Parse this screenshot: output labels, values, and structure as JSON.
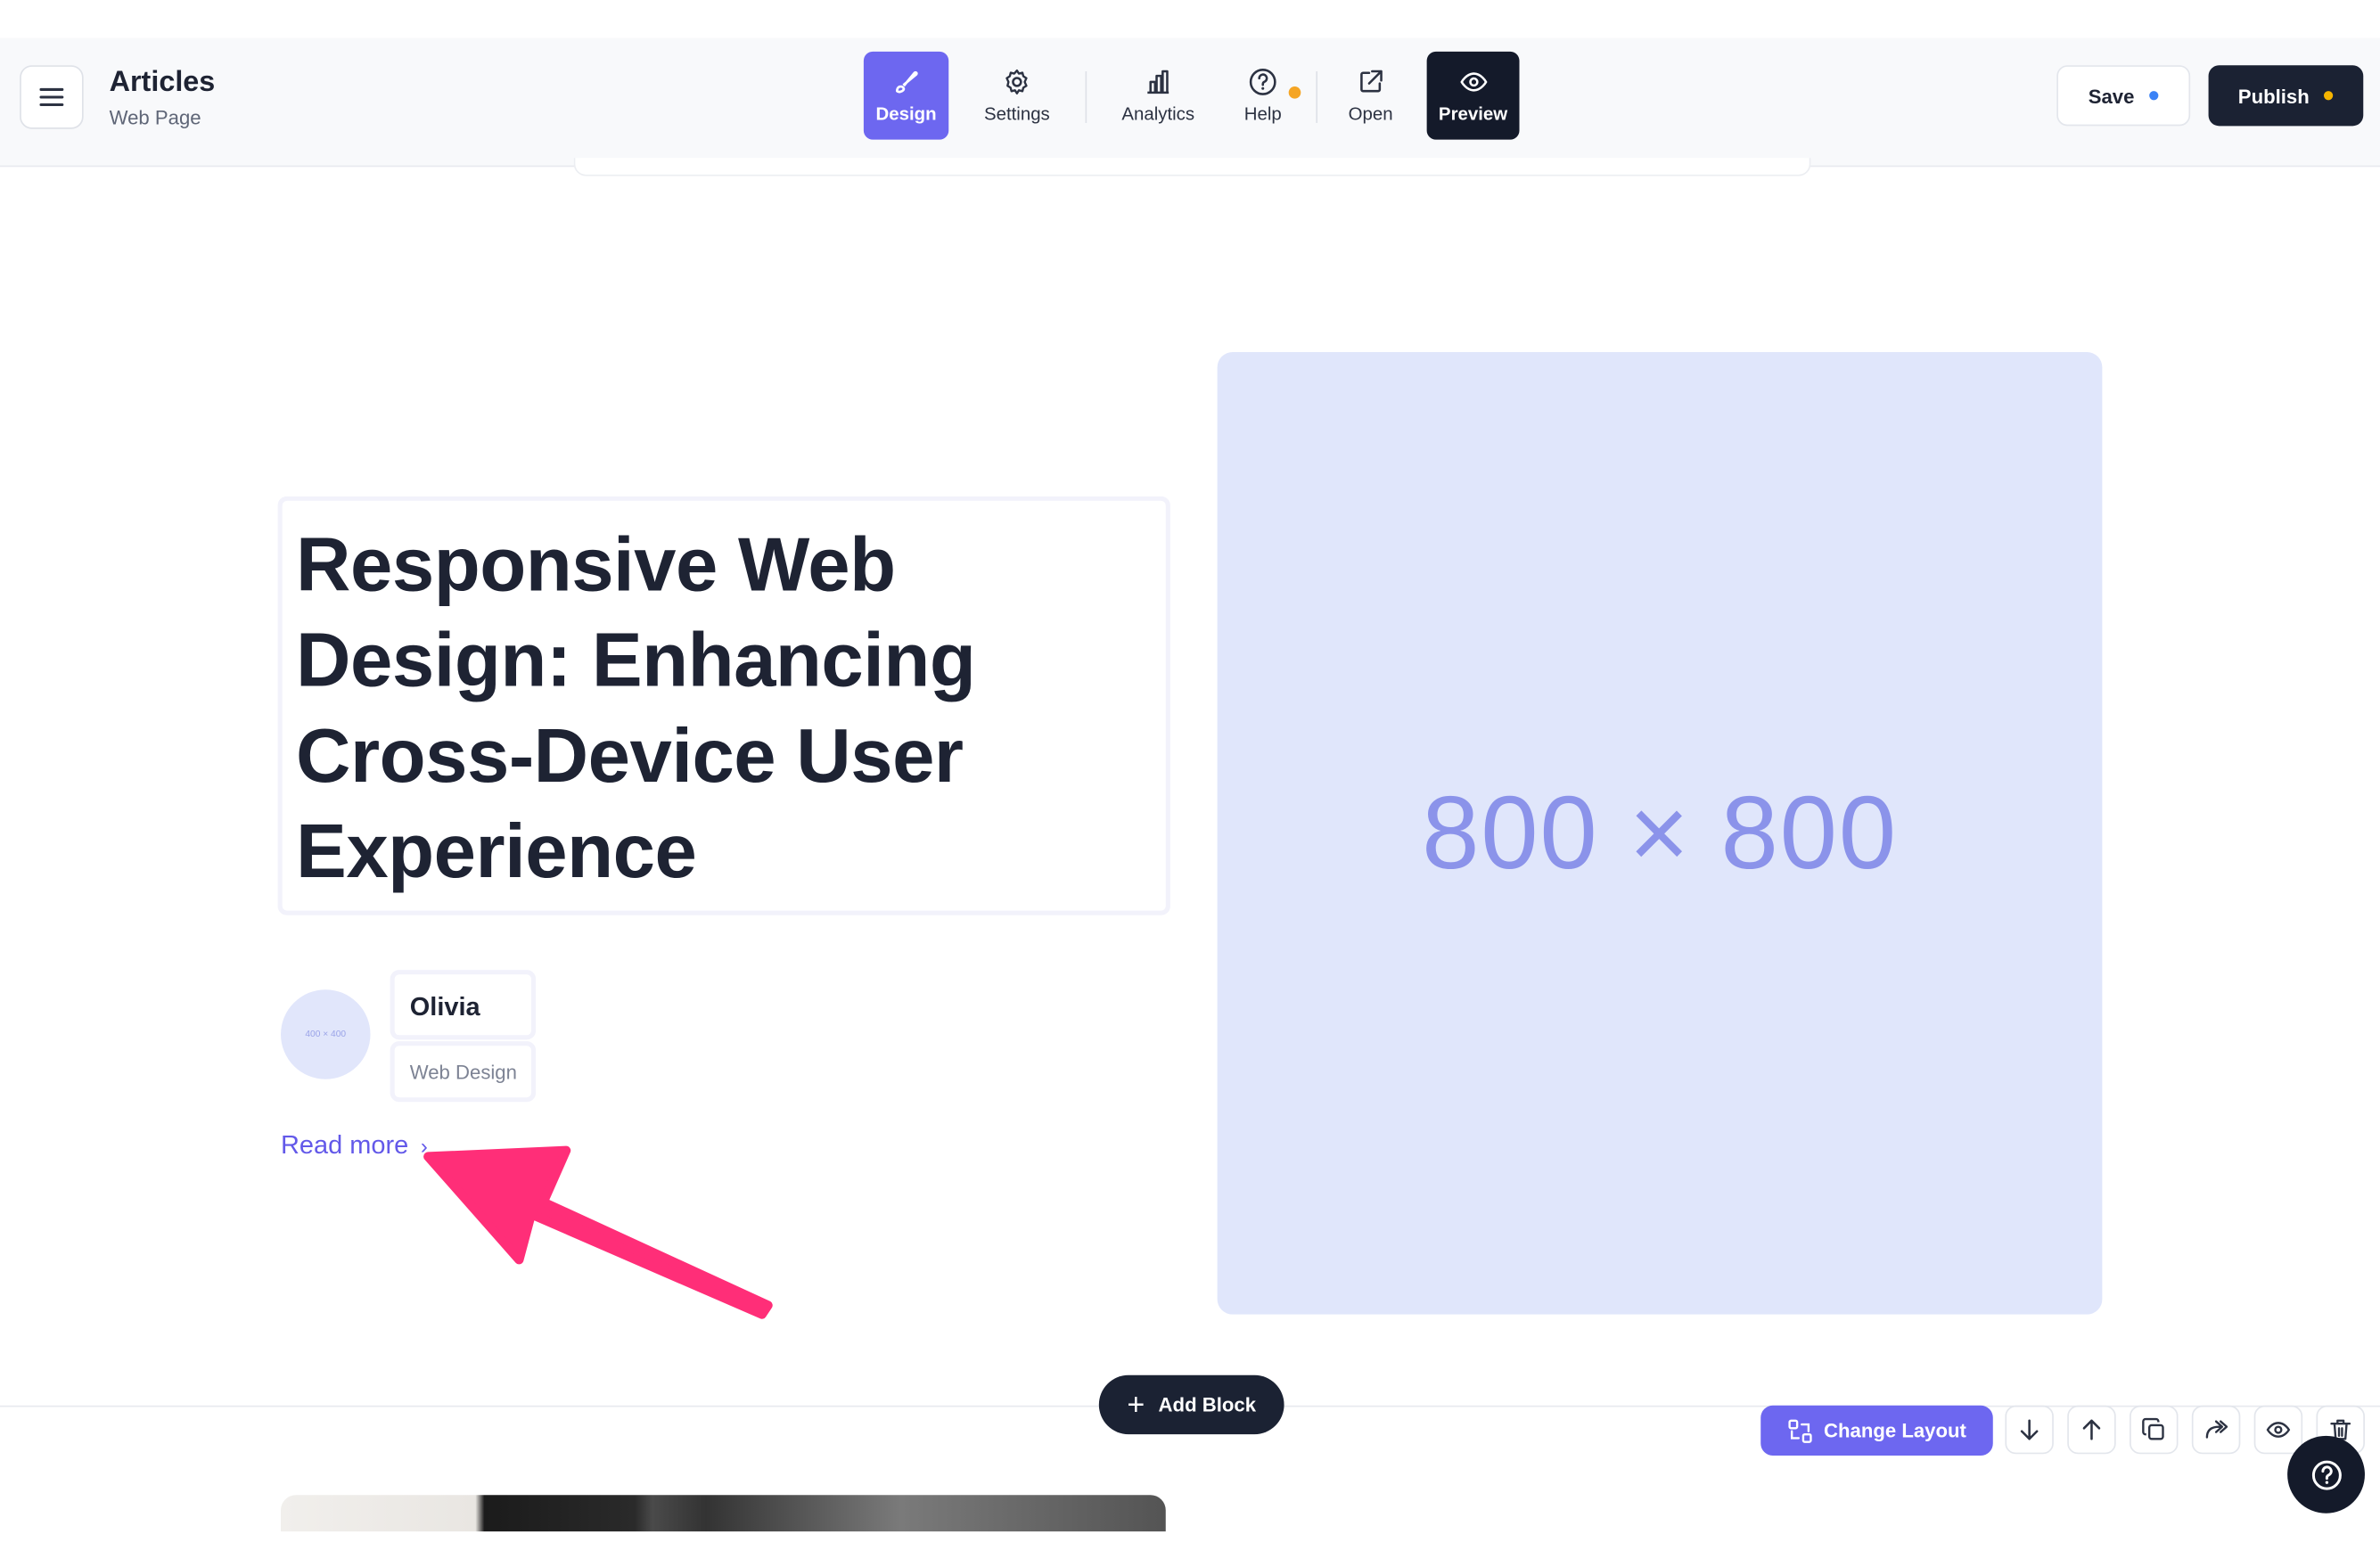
{
  "app": {
    "title": "Articles",
    "subtitle": "Web Page"
  },
  "toolbar": {
    "tools": [
      {
        "label": "Design",
        "icon": "brush-icon"
      },
      {
        "label": "Settings",
        "icon": "gear-icon"
      },
      {
        "label": "Analytics",
        "icon": "bar-chart-icon"
      },
      {
        "label": "Help",
        "icon": "question-circle-icon"
      },
      {
        "label": "Open",
        "icon": "external-link-icon"
      },
      {
        "label": "Preview",
        "icon": "eye-icon"
      }
    ],
    "save_label": "Save",
    "publish_label": "Publish"
  },
  "colors": {
    "accent": "#6d67f0",
    "dark": "#141a2a",
    "save_dot": "#3b82f6",
    "publish_dot": "#f5b400",
    "notification_dot": "#f5a524",
    "highlight_arrow": "#ff2e78"
  },
  "article": {
    "headline": "Responsive Web Design: Enhancing Cross-Device User Experience",
    "avatar_placeholder": "400 × 400",
    "author_name": "Olivia",
    "category": "Web Design",
    "read_more": "Read more",
    "image_placeholder": "800 × 800"
  },
  "block_controls": {
    "add_block": "Add Block",
    "change_layout": "Change Layout",
    "icons": [
      "arrow-down-icon",
      "arrow-up-icon",
      "duplicate-icon",
      "share-icon",
      "eye-icon",
      "trash-icon"
    ]
  }
}
